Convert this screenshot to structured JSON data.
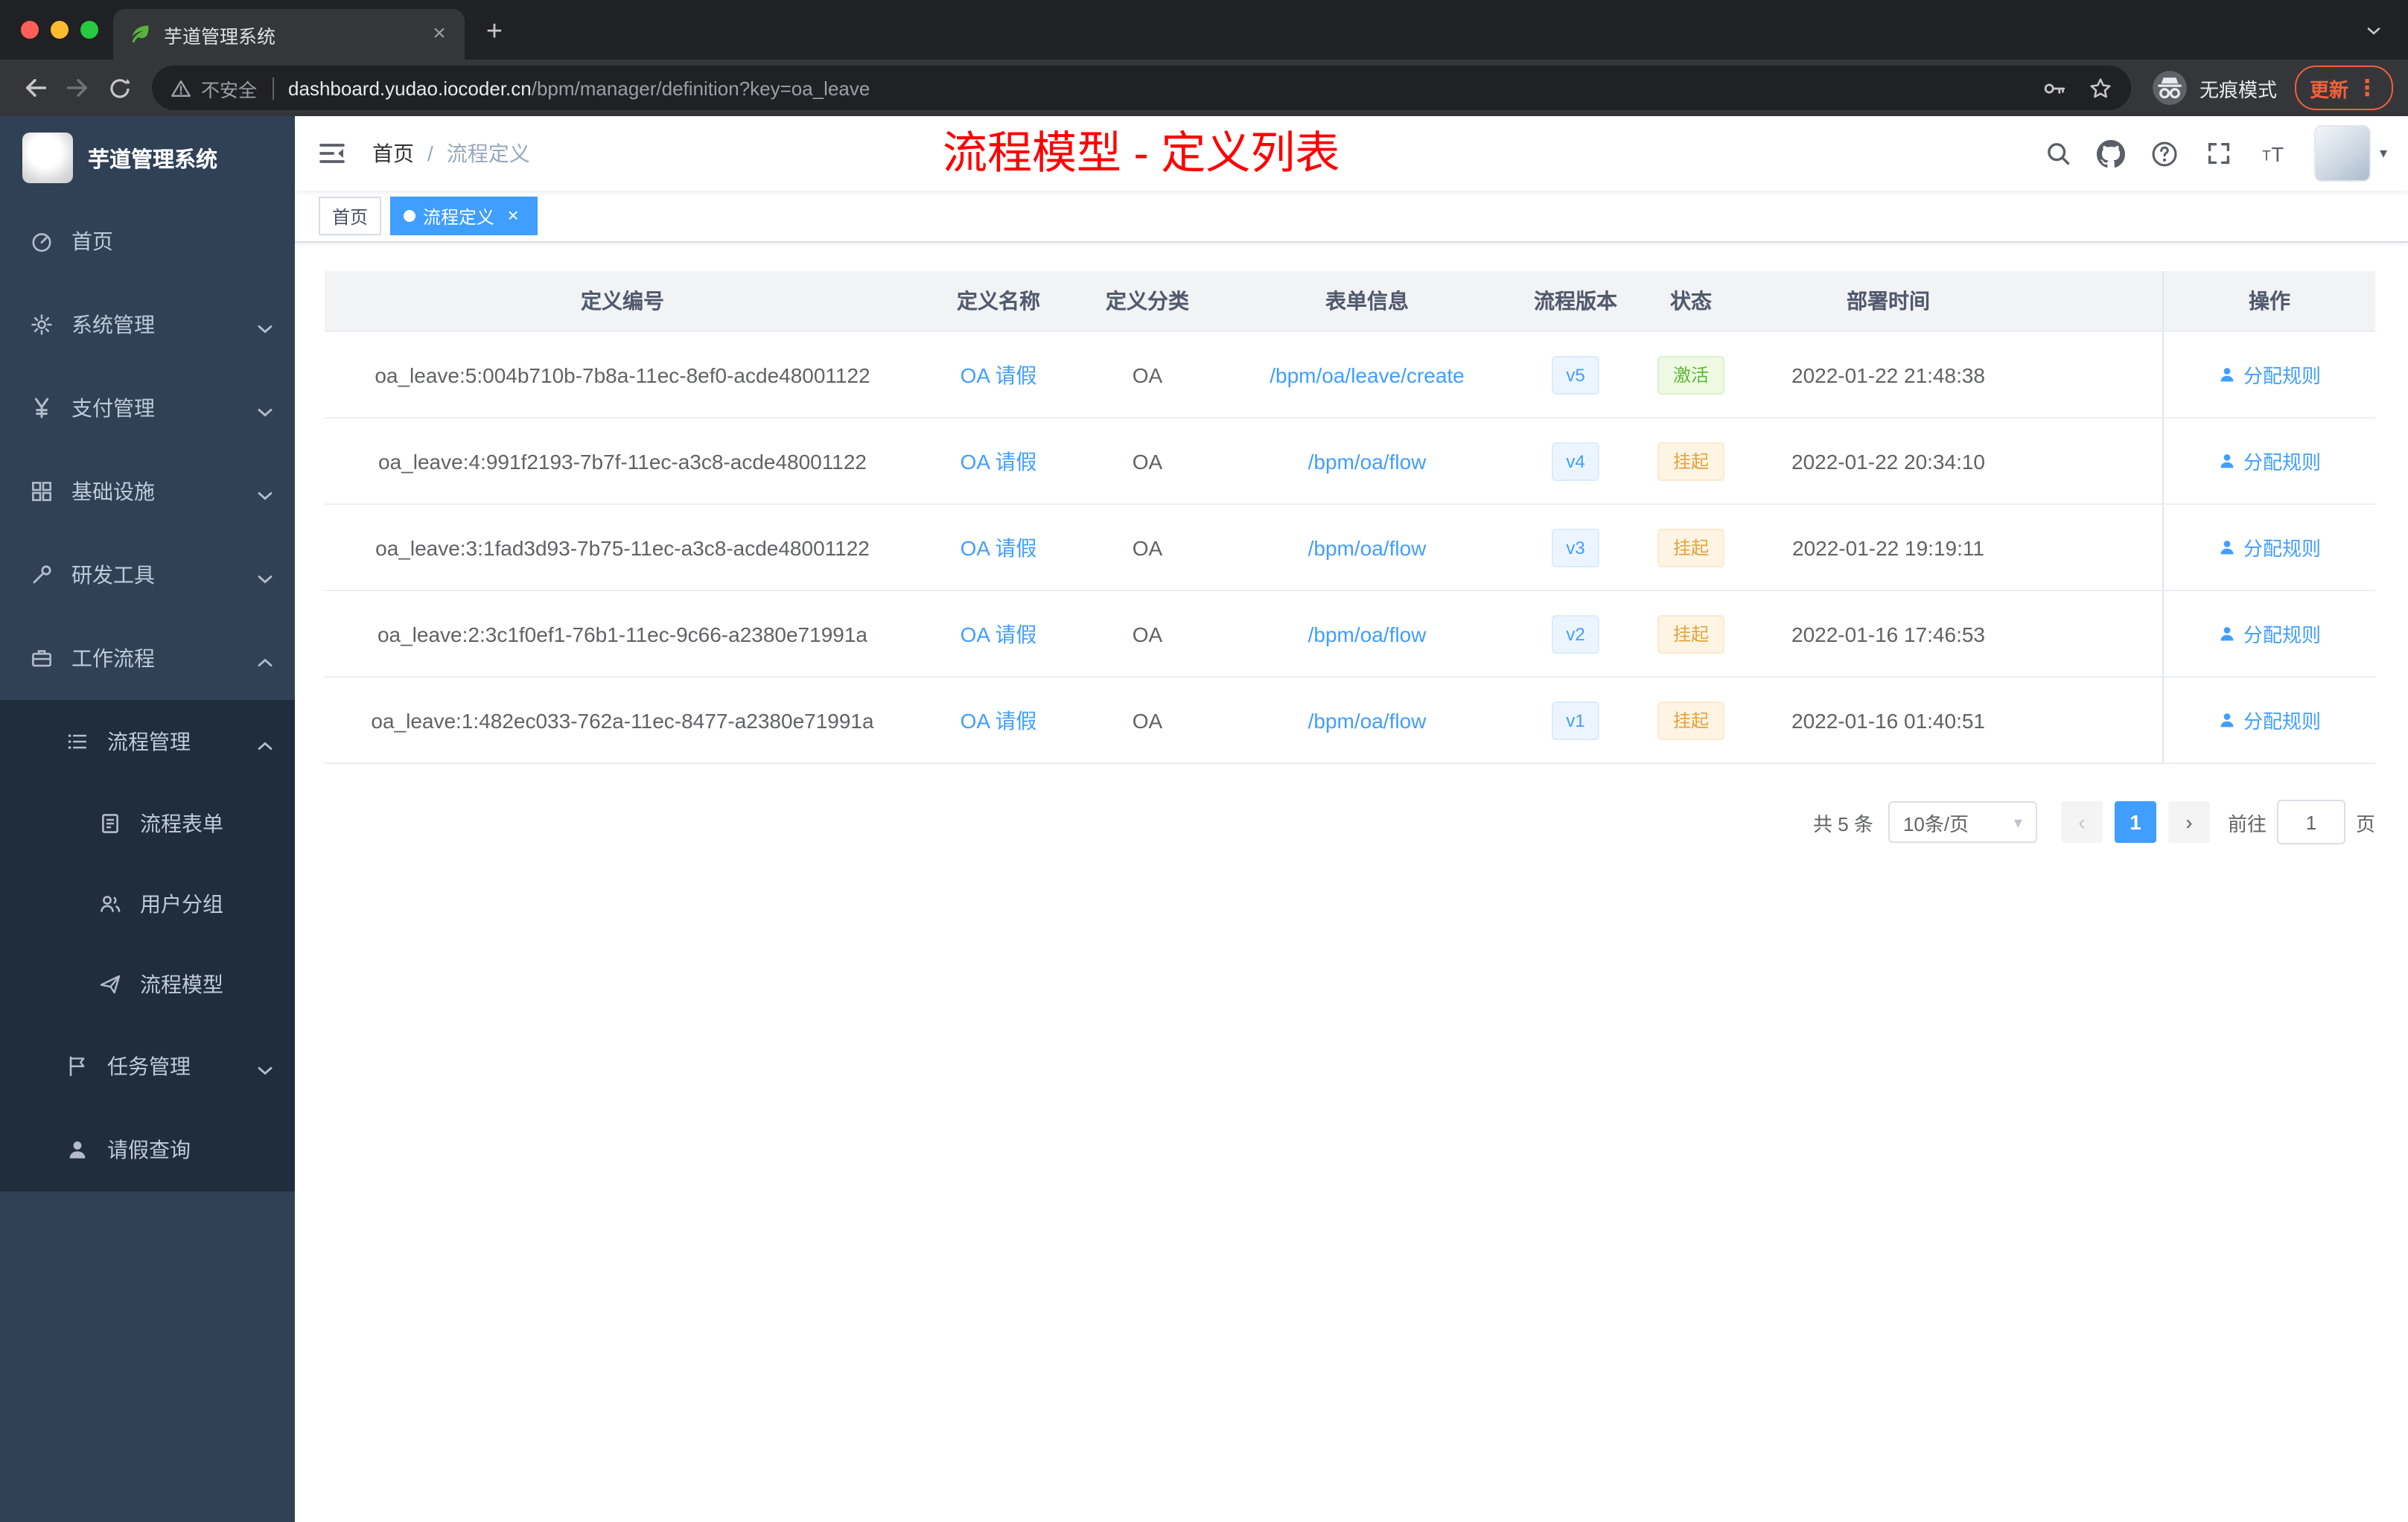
{
  "glyphs": {
    "tab_close": "×",
    "new_tab": "+",
    "window_caret": "⌄",
    "more": "⋮",
    "tag_close": "×",
    "prev": "‹",
    "next": "›",
    "select_caret": "▾",
    "avatar_caret": "▾"
  },
  "colors": {
    "annotation_red": "#fe0000",
    "accent_blue": "#409eff",
    "success_green": "#5ab733",
    "warning_orange": "#e6a23c",
    "sidebar_bg": "#304156",
    "submenu_bg": "#1f2d3d",
    "traffic_close": "#ff5f57",
    "traffic_min": "#febc2e",
    "traffic_zoom": "#28c840",
    "update_accent": "#f06038"
  },
  "browser": {
    "tab": {
      "title": "芋道管理系统"
    },
    "address": {
      "security_label": "不安全",
      "url_host": "dashboard.yudao.iocoder.cn",
      "url_path": "/bpm/manager/definition?key=oa_leave",
      "incognito_label": "无痕模式",
      "update_label": "更新"
    }
  },
  "sidebar": {
    "logo_title": "芋道管理系统",
    "items": [
      {
        "name": "home",
        "label": "首页",
        "icon": "dashboard",
        "level": 1
      },
      {
        "name": "system-mgmt",
        "label": "系统管理",
        "icon": "gear",
        "level": 1,
        "arrow": "down"
      },
      {
        "name": "payment-mgmt",
        "label": "支付管理",
        "icon": "yen",
        "level": 1,
        "arrow": "down"
      },
      {
        "name": "infrastructure",
        "label": "基础设施",
        "icon": "grid",
        "level": 1,
        "arrow": "down"
      },
      {
        "name": "dev-tools",
        "label": "研发工具",
        "icon": "tools",
        "level": 1,
        "arrow": "down"
      },
      {
        "name": "workflow",
        "label": "工作流程",
        "icon": "briefcase",
        "level": 1,
        "arrow": "up"
      },
      {
        "name": "process-mgmt",
        "label": "流程管理",
        "icon": "list",
        "level": 2,
        "arrow": "up",
        "dark": true
      },
      {
        "name": "process-form",
        "label": "流程表单",
        "icon": "form",
        "level": 3,
        "dark": true
      },
      {
        "name": "user-group",
        "label": "用户分组",
        "icon": "users",
        "level": 3,
        "dark": true
      },
      {
        "name": "process-model",
        "label": "流程模型",
        "icon": "plane",
        "level": 3,
        "dark": true
      },
      {
        "name": "task-mgmt",
        "label": "任务管理",
        "icon": "flag",
        "level": 2,
        "arrow": "down",
        "dark": true
      },
      {
        "name": "leave-query",
        "label": "请假查询",
        "icon": "person",
        "level": 2,
        "dark": true
      }
    ]
  },
  "header": {
    "breadcrumb": [
      "首页",
      "流程定义"
    ],
    "breadcrumb_separator": "/",
    "annotation": "流程模型 - 定义列表"
  },
  "tags": [
    {
      "name": "home",
      "label": "首页",
      "active": false,
      "closable": false
    },
    {
      "name": "process-definition",
      "label": "流程定义",
      "active": true,
      "closable": true
    }
  ],
  "table": {
    "columns": [
      "定义编号",
      "定义名称",
      "定义分类",
      "表单信息",
      "流程版本",
      "状态",
      "部署时间",
      "操作"
    ],
    "rows": [
      {
        "id": "oa_leave:5:004b710b-7b8a-11ec-8ef0-acde48001122",
        "name": "OA 请假",
        "category": "OA",
        "form": "/bpm/oa/leave/create",
        "version": "v5",
        "status": "激活",
        "status_type": "success",
        "deployed_at": "2022-01-22 21:48:38",
        "action": "分配规则"
      },
      {
        "id": "oa_leave:4:991f2193-7b7f-11ec-a3c8-acde48001122",
        "name": "OA 请假",
        "category": "OA",
        "form": "/bpm/oa/flow",
        "version": "v4",
        "status": "挂起",
        "status_type": "warning",
        "deployed_at": "2022-01-22 20:34:10",
        "action": "分配规则"
      },
      {
        "id": "oa_leave:3:1fad3d93-7b75-11ec-a3c8-acde48001122",
        "name": "OA 请假",
        "category": "OA",
        "form": "/bpm/oa/flow",
        "version": "v3",
        "status": "挂起",
        "status_type": "warning",
        "deployed_at": "2022-01-22 19:19:11",
        "action": "分配规则"
      },
      {
        "id": "oa_leave:2:3c1f0ef1-76b1-11ec-9c66-a2380e71991a",
        "name": "OA 请假",
        "category": "OA",
        "form": "/bpm/oa/flow",
        "version": "v2",
        "status": "挂起",
        "status_type": "warning",
        "deployed_at": "2022-01-16 17:46:53",
        "action": "分配规则"
      },
      {
        "id": "oa_leave:1:482ec033-762a-11ec-8477-a2380e71991a",
        "name": "OA 请假",
        "category": "OA",
        "form": "/bpm/oa/flow",
        "version": "v1",
        "status": "挂起",
        "status_type": "warning",
        "deployed_at": "2022-01-16 01:40:51",
        "action": "分配规则"
      }
    ]
  },
  "pagination": {
    "total": "共 5 条",
    "page_size": "10条/页",
    "current_page": "1",
    "goto_label": "前往",
    "goto_value": "1",
    "page_label": "页"
  }
}
